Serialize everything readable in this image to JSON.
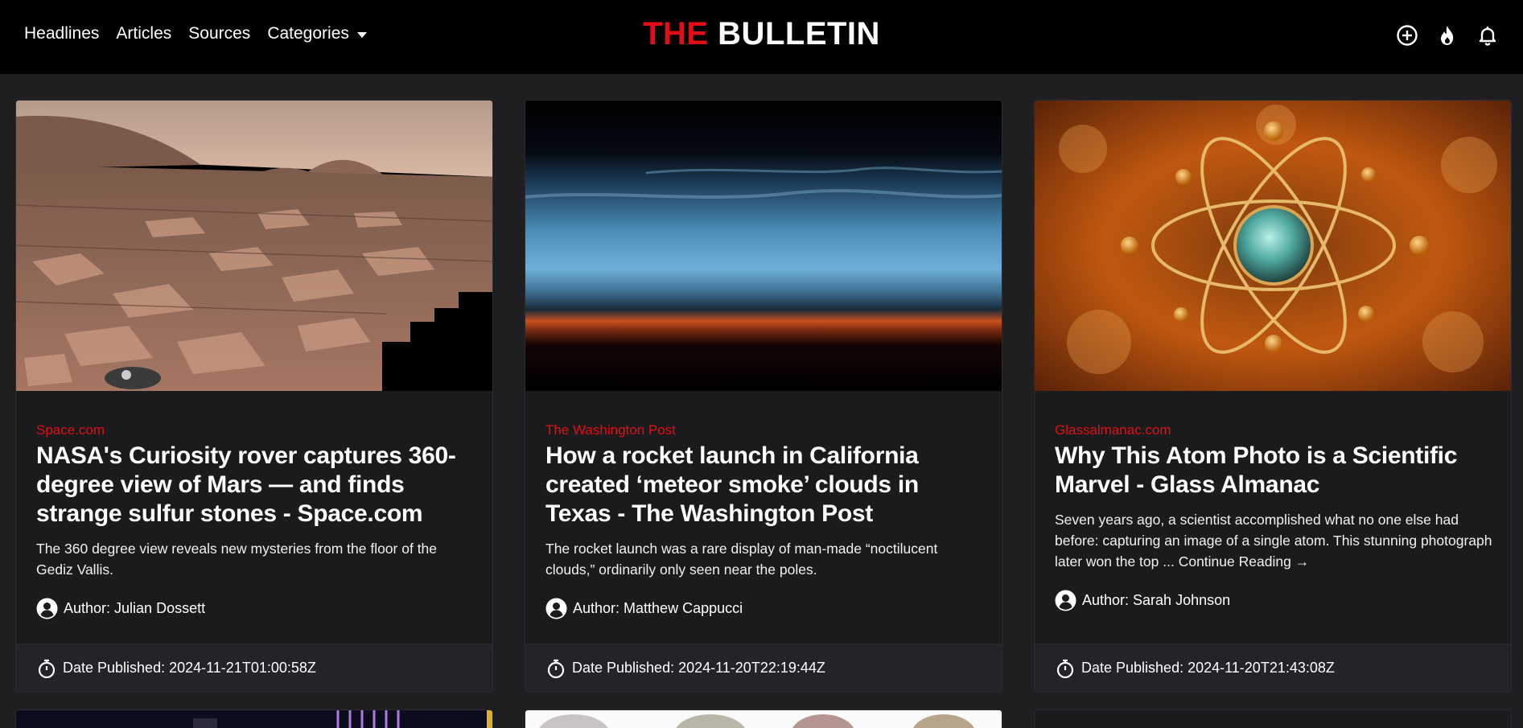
{
  "nav": {
    "links": [
      "Headlines",
      "Articles",
      "Sources"
    ],
    "categories_label": "Categories",
    "brand_the": "THE",
    "brand_bulletin": "BULLETIN",
    "icons": [
      "plus-circle-icon",
      "flame-icon",
      "bell-icon"
    ]
  },
  "colors": {
    "accent": "#e20d16",
    "background": "#1f1f22",
    "card": "#1b1b1e",
    "navbar": "#000000"
  },
  "cards": [
    {
      "source": "Space.com",
      "title": "NASA's Curiosity rover captures 360-degree view of Mars — and finds strange sulfur stones - Space.com",
      "description": "The 360 degree view reveals new mysteries from the floor of the Gediz Vallis.",
      "author": "Author: Julian Dossett",
      "date": "Date Published: 2024-11-21T01:00:58Z"
    },
    {
      "source": "The Washington Post",
      "title": "How a rocket launch in California created ‘meteor smoke’ clouds in Texas - The Washington Post",
      "description": "The rocket launch was a rare display of man-made “noctilucent clouds,” ordinarily only seen near the poles.",
      "author": "Author: Matthew Cappucci",
      "date": "Date Published: 2024-11-20T22:19:44Z"
    },
    {
      "source": "Glassalmanac.com",
      "title": "Why This Atom Photo is a Scientific Marvel - Glass Almanac",
      "description": "Seven years ago, a scientist accomplished what no one else had before: capturing an image of a single atom. This stunning photograph later won the top ... Continue Reading →",
      "author": "Author: Sarah Johnson",
      "date": "Date Published: 2024-11-20T21:43:08Z"
    }
  ]
}
